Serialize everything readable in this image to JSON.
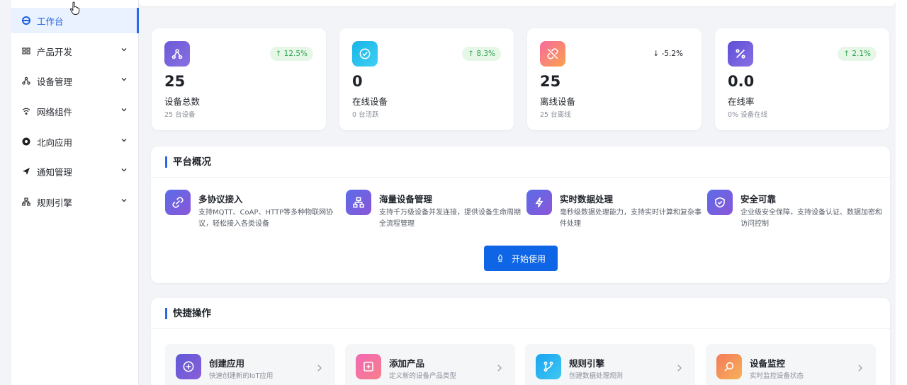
{
  "sidebar": {
    "items": [
      {
        "label": "工作台",
        "icon": "dashboard-icon",
        "active": true
      },
      {
        "label": "产品开发",
        "icon": "grid-icon"
      },
      {
        "label": "设备管理",
        "icon": "network-icon"
      },
      {
        "label": "网络组件",
        "icon": "wifi-icon"
      },
      {
        "label": "北向应用",
        "icon": "app-icon"
      },
      {
        "label": "通知管理",
        "icon": "send-icon"
      },
      {
        "label": "规则引擎",
        "icon": "org-icon"
      }
    ]
  },
  "stats": [
    {
      "value": "25",
      "label": "设备总数",
      "sub": "25 台设备",
      "trend": "↑ 12.5%",
      "trend_dir": "up",
      "icon": "network-icon",
      "color": "#6b5bd6"
    },
    {
      "value": "0",
      "label": "在线设备",
      "sub": "0 台活跃",
      "trend": "↑ 8.3%",
      "trend_dir": "up",
      "icon": "check-circle-icon",
      "color": "#22b7e8"
    },
    {
      "value": "25",
      "label": "离线设备",
      "sub": "25 台离线",
      "trend": "↓ -5.2%",
      "trend_dir": "down",
      "icon": "link-off-icon",
      "color": "#f2708a"
    },
    {
      "value": "0.0",
      "label": "在线率",
      "sub": "0% 设备在线",
      "trend": "↑ 2.1%",
      "trend_dir": "up",
      "icon": "percent-icon",
      "color": "#6a55d9"
    }
  ],
  "overview": {
    "title": "平台概况",
    "features": [
      {
        "title": "多协议接入",
        "desc": "支持MQTT、CoAP、HTTP等多种物联网协议，轻松接入各类设备",
        "icon": "link-icon"
      },
      {
        "title": "海量设备管理",
        "desc": "支持千万级设备并发连接，提供设备生命周期全流程管理",
        "icon": "org-icon"
      },
      {
        "title": "实时数据处理",
        "desc": "毫秒级数据处理能力，支持实时计算和复杂事件处理",
        "icon": "lightning-icon"
      },
      {
        "title": "安全可靠",
        "desc": "企业级安全保障，支持设备认证、数据加密和访问控制",
        "icon": "shield-icon"
      }
    ],
    "start_label": "开始使用"
  },
  "quick": {
    "title": "快捷操作",
    "actions": [
      {
        "title": "创建应用",
        "desc": "快速创建新的IoT应用",
        "icon": "plus-circle-icon",
        "color": "#6a5bd8"
      },
      {
        "title": "添加产品",
        "desc": "定义新的设备产品类型",
        "icon": "add-box-icon",
        "color": "#f06aa4"
      },
      {
        "title": "规则引擎",
        "desc": "创建数据处理规则",
        "icon": "branch-icon",
        "color": "#1fb0f0"
      },
      {
        "title": "设备监控",
        "desc": "实时监控设备状态",
        "icon": "monitor-search-icon",
        "color": "#f28a5a"
      }
    ]
  }
}
